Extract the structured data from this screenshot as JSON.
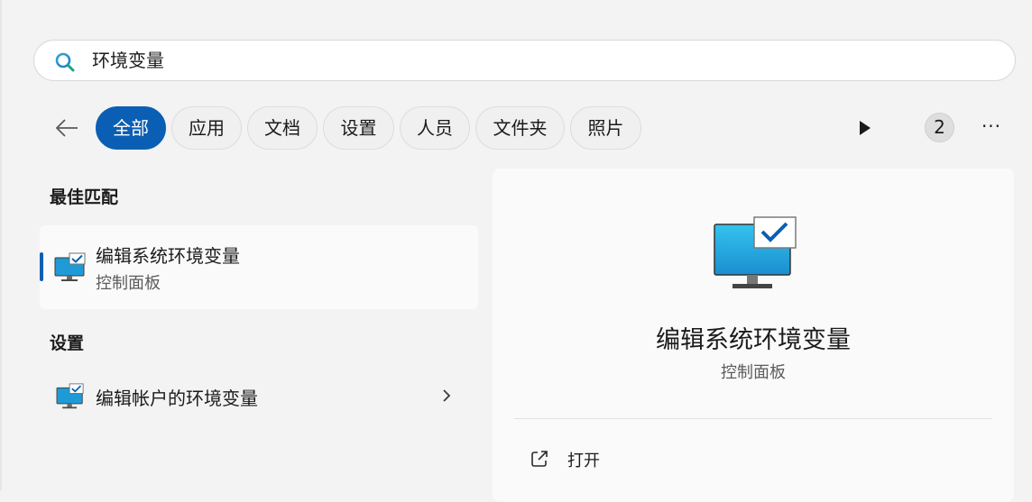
{
  "search": {
    "query": "环境变量"
  },
  "filters": [
    "全部",
    "应用",
    "文档",
    "设置",
    "人员",
    "文件夹",
    "照片"
  ],
  "toolbar": {
    "badge_count": "2",
    "more_label": "···"
  },
  "best_match": {
    "heading": "最佳匹配",
    "title": "编辑系统环境变量",
    "subtitle": "控制面板"
  },
  "settings": {
    "heading": "设置",
    "items": [
      {
        "label": "编辑帐户的环境变量"
      }
    ]
  },
  "preview": {
    "title": "编辑系统环境变量",
    "subtitle": "控制面板",
    "action_label": "打开"
  },
  "colors": {
    "accent": "#0a5fb4",
    "monitor": "#1e9bd7",
    "check": "#0a5fb4"
  },
  "icons": [
    "search-icon",
    "back-arrow-icon",
    "play-icon",
    "more-icon",
    "monitor-check-icon",
    "chevron-right-icon",
    "open-external-icon"
  ]
}
